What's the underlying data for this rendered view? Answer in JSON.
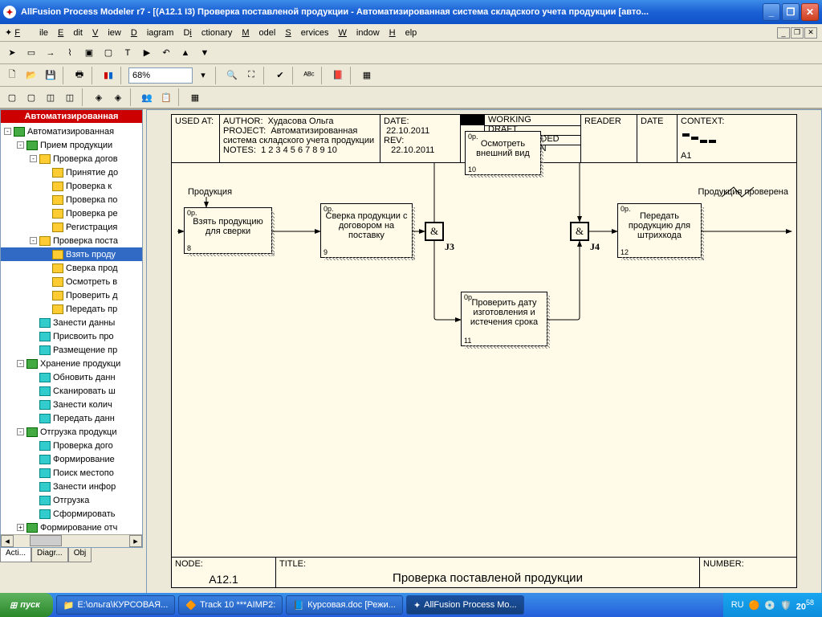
{
  "window": {
    "title": "AllFusion Process Modeler r7 - [(A12.1 I3) Проверка поставленой продукции - Автоматизированная система складского учета продукции [авто..."
  },
  "menu": {
    "file": "File",
    "edit": "Edit",
    "view": "View",
    "diagram": "Diagram",
    "dictionary": "Dictionary",
    "model": "Model",
    "services": "Services",
    "window": "Window",
    "help": "Help"
  },
  "toolbar": {
    "zoom": "68%"
  },
  "tree": {
    "header": "Автоматизированная",
    "items": [
      {
        "ind": 0,
        "icon": "green",
        "toggle": "-",
        "text": "Автоматизированная"
      },
      {
        "ind": 1,
        "icon": "green",
        "toggle": "-",
        "text": "Прием продукции"
      },
      {
        "ind": 2,
        "icon": "yellow",
        "toggle": "-",
        "text": "Проверка догов"
      },
      {
        "ind": 3,
        "icon": "yellow",
        "toggle": "",
        "text": "Принятие до"
      },
      {
        "ind": 3,
        "icon": "yellow",
        "toggle": "",
        "text": "Проверка к"
      },
      {
        "ind": 3,
        "icon": "yellow",
        "toggle": "",
        "text": "Проверка по"
      },
      {
        "ind": 3,
        "icon": "yellow",
        "toggle": "",
        "text": "Проверка ре"
      },
      {
        "ind": 3,
        "icon": "yellow",
        "toggle": "",
        "text": "Регистрация"
      },
      {
        "ind": 2,
        "icon": "yellow",
        "toggle": "-",
        "text": "Проверка поста"
      },
      {
        "ind": 3,
        "icon": "yellow",
        "toggle": "",
        "text": "Взять проду",
        "sel": true
      },
      {
        "ind": 3,
        "icon": "yellow",
        "toggle": "",
        "text": "Сверка прод"
      },
      {
        "ind": 3,
        "icon": "yellow",
        "toggle": "",
        "text": "Осмотреть в"
      },
      {
        "ind": 3,
        "icon": "yellow",
        "toggle": "",
        "text": "Проверить д"
      },
      {
        "ind": 3,
        "icon": "yellow",
        "toggle": "",
        "text": "Передать пр"
      },
      {
        "ind": 2,
        "icon": "cyan",
        "toggle": "",
        "text": "Занести данны"
      },
      {
        "ind": 2,
        "icon": "cyan",
        "toggle": "",
        "text": "Присвоить про"
      },
      {
        "ind": 2,
        "icon": "cyan",
        "toggle": "",
        "text": "Размещение пр"
      },
      {
        "ind": 1,
        "icon": "green",
        "toggle": "-",
        "text": "Хранение продукци"
      },
      {
        "ind": 2,
        "icon": "cyan",
        "toggle": "",
        "text": "Обновить данн"
      },
      {
        "ind": 2,
        "icon": "cyan",
        "toggle": "",
        "text": "Сканировать ш"
      },
      {
        "ind": 2,
        "icon": "cyan",
        "toggle": "",
        "text": "Занести колич"
      },
      {
        "ind": 2,
        "icon": "cyan",
        "toggle": "",
        "text": "Передать данн"
      },
      {
        "ind": 1,
        "icon": "green",
        "toggle": "-",
        "text": "Отгрузка продукци"
      },
      {
        "ind": 2,
        "icon": "cyan",
        "toggle": "",
        "text": "Проверка дого"
      },
      {
        "ind": 2,
        "icon": "cyan",
        "toggle": "",
        "text": "Формирование"
      },
      {
        "ind": 2,
        "icon": "cyan",
        "toggle": "",
        "text": "Поиск местопо"
      },
      {
        "ind": 2,
        "icon": "cyan",
        "toggle": "",
        "text": "Занести инфор"
      },
      {
        "ind": 2,
        "icon": "cyan",
        "toggle": "",
        "text": "Отгрузка"
      },
      {
        "ind": 2,
        "icon": "cyan",
        "toggle": "",
        "text": "Сформировать"
      },
      {
        "ind": 1,
        "icon": "green",
        "toggle": "+",
        "text": "Формирование отч"
      }
    ],
    "tabs": {
      "acts": "Acti...",
      "diags": "Diagr...",
      "objs": "Obj"
    }
  },
  "header": {
    "usedat": "USED AT:",
    "author_l": "AUTHOR:",
    "author_v": "Худасова Ольга",
    "project_l": "PROJECT:",
    "project_v": "Автоматизированная система складского учета продукции",
    "notes_l": "NOTES:",
    "notes_v": "1 2 3 4 5 6 7 8 9 10",
    "date_l": "DATE:",
    "date_v": "22.10.2011",
    "rev_l": "REV:",
    "rev_v": "22.10.2011",
    "working": "WORKING",
    "draft": "DRAFT",
    "recommended": "RECOMMENDED",
    "publication": "PUBLICATION",
    "reader": "READER",
    "date": "DATE",
    "context": "CONTEXT:",
    "ctx_id": "A1"
  },
  "diagram": {
    "input_label": "Продукция",
    "output_label": "Продукция проверена",
    "b1": {
      "op": "0р.",
      "text": "Взять продукцию для сверки",
      "num": "8"
    },
    "b2": {
      "op": "0р.",
      "text": "Сверка продукции с договором на поставку",
      "num": "9"
    },
    "b3": {
      "op": "0р.",
      "text": "Осмотреть внешний вид",
      "num": "10"
    },
    "b4": {
      "op": "0р.",
      "text": "Проверить дату изготовления и истечения срока",
      "num": "11"
    },
    "b5": {
      "op": "0р.",
      "text": "Передать продукцию для штрихкода",
      "num": "12"
    },
    "j3": "&",
    "j3l": "J3",
    "j4": "&",
    "j4l": "J4"
  },
  "footer": {
    "node_l": "NODE:",
    "node_v": "A12.1",
    "title_l": "TITLE:",
    "title_v": "Проверка поставленой продукции",
    "number_l": "NUMBER:"
  },
  "taskbar": {
    "start": "пуск",
    "t1": "E:\\ольга\\КУРСОВАЯ...",
    "t2": "Track 10 ***AIMP2:",
    "t3": "Курсовая.doc [Режи...",
    "t4": "AllFusion Process Mo...",
    "lang": "RU",
    "time": "20",
    "time_sub": "58"
  }
}
